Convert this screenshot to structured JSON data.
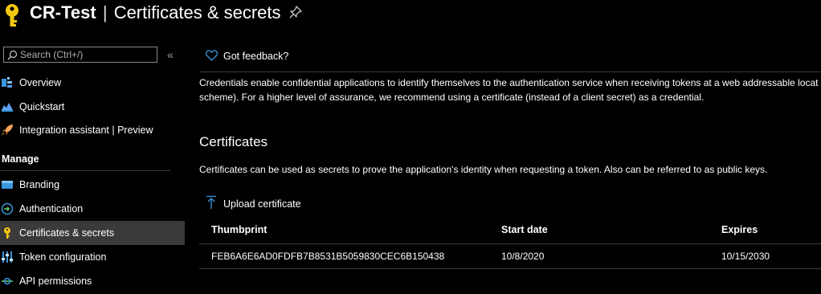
{
  "header": {
    "app_name": "CR-Test",
    "separator": "|",
    "page_title": "Certificates & secrets"
  },
  "sidebar": {
    "search_placeholder": "Search (Ctrl+/)",
    "collapse_glyph": "«",
    "items": [
      {
        "label": "Overview",
        "icon": "overview-icon"
      },
      {
        "label": "Quickstart",
        "icon": "quickstart-icon"
      },
      {
        "label": "Integration assistant | Preview",
        "icon": "rocket-icon"
      }
    ],
    "manage_heading": "Manage",
    "manage_items": [
      {
        "label": "Branding",
        "icon": "branding-icon"
      },
      {
        "label": "Authentication",
        "icon": "authentication-icon"
      },
      {
        "label": "Certificates & secrets",
        "icon": "key-icon",
        "active": true
      },
      {
        "label": "Token configuration",
        "icon": "token-config-icon"
      },
      {
        "label": "API permissions",
        "icon": "api-permissions-icon"
      }
    ]
  },
  "main": {
    "feedback_label": "Got feedback?",
    "description_line1": "Credentials enable confidential applications to identify themselves to the authentication service when receiving tokens at a web addressable locat",
    "description_line2": "scheme). For a higher level of assurance, we recommend using a certificate (instead of a client secret) as a credential.",
    "certificates": {
      "title": "Certificates",
      "description": "Certificates can be used as secrets to prove the application's identity when requesting a token. Also can be referred to as public keys.",
      "upload_label": "Upload certificate",
      "columns": [
        "Thumbprint",
        "Start date",
        "Expires"
      ],
      "rows": [
        {
          "thumbprint": "FEB6A6E6AD0FDFB7B8531B5059830CEC6B150438",
          "start_date": "10/8/2020",
          "expires": "10/15/2030"
        }
      ]
    }
  },
  "colors": {
    "background": "#000000",
    "active_item": "#3b3a39",
    "accent_blue": "#3a96dd",
    "key_yellow": "#f2c811",
    "divider": "#3b3a39"
  }
}
